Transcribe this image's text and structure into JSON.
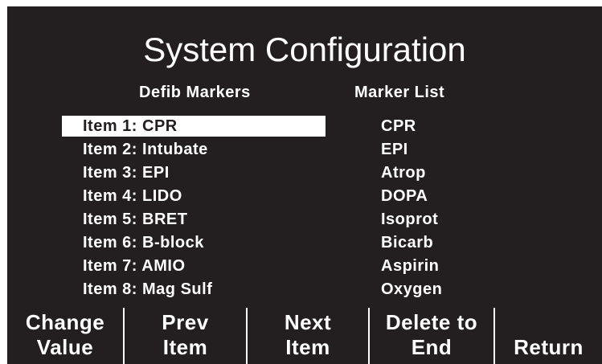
{
  "screen": {
    "title": "System Configuration",
    "left_header": "Defib Markers",
    "right_header": "Marker List"
  },
  "items": [
    {
      "label": "Item 1: CPR",
      "selected": true
    },
    {
      "label": "Item 2: Intubate",
      "selected": false
    },
    {
      "label": "Item 3: EPI",
      "selected": false
    },
    {
      "label": "Item 4: LIDO",
      "selected": false
    },
    {
      "label": "Item 5: BRET",
      "selected": false
    },
    {
      "label": "Item 6: B-block",
      "selected": false
    },
    {
      "label": "Item 7: AMIO",
      "selected": false
    },
    {
      "label": "Item 8: Mag Sulf",
      "selected": false
    }
  ],
  "marker_list": [
    "CPR",
    "EPI",
    "Atrop",
    "DOPA",
    "Isoprot",
    "Bicarb",
    "Aspirin",
    "Oxygen"
  ],
  "softkeys": [
    {
      "line1": "Change",
      "line2": "Value"
    },
    {
      "line1": "Prev",
      "line2": "Item"
    },
    {
      "line1": "Next",
      "line2": "Item"
    },
    {
      "line1": "Delete to",
      "line2": "End"
    },
    {
      "line1": "",
      "line2": "Return"
    }
  ],
  "colors": {
    "background": "#231f20",
    "foreground": "#ffffff",
    "highlight": "#ffffff"
  }
}
